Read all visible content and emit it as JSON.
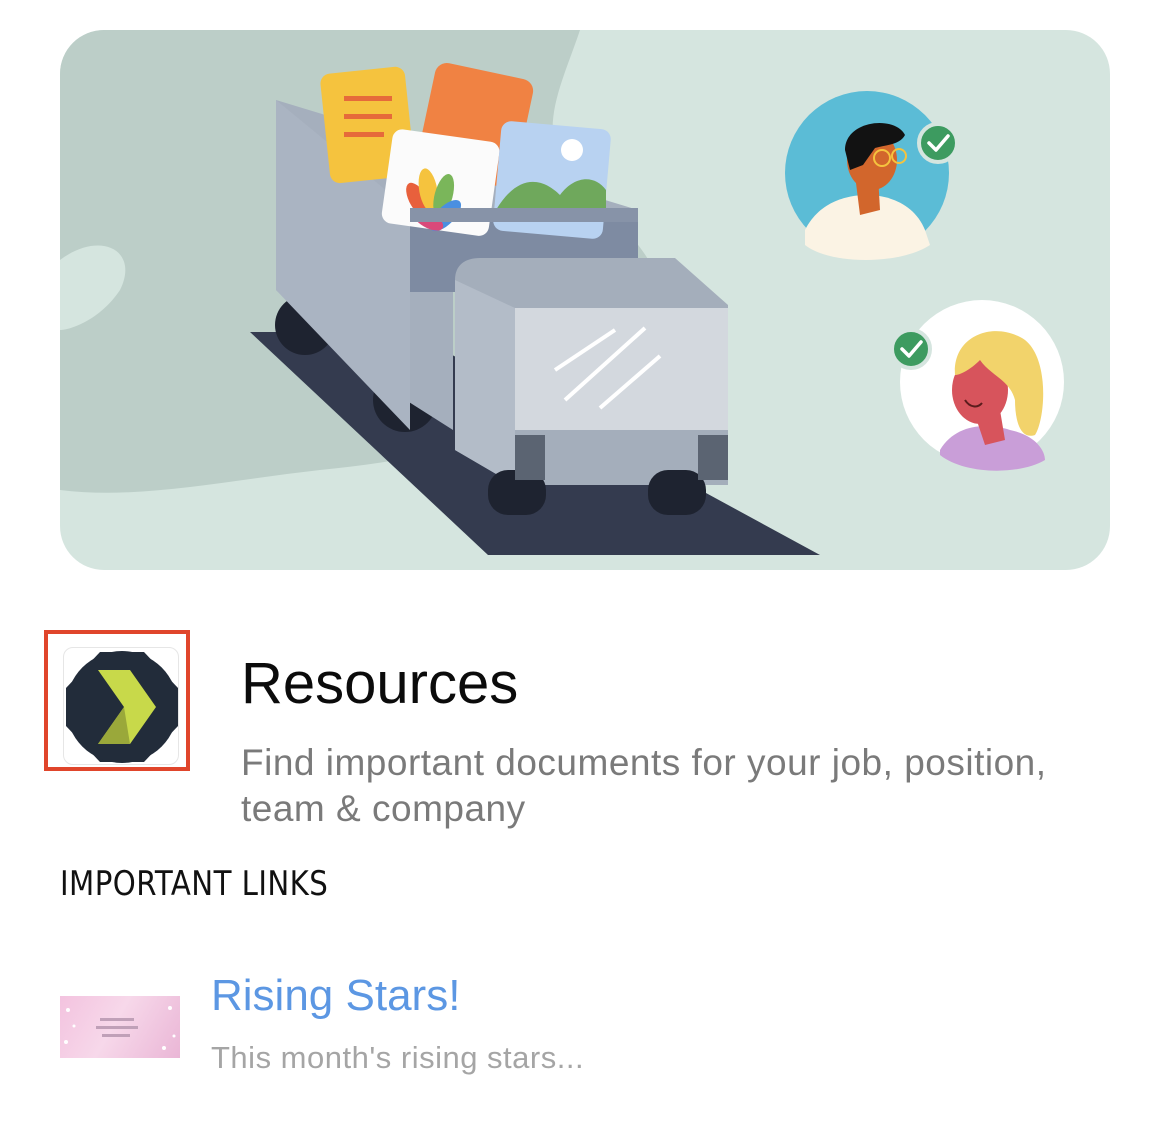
{
  "header": {
    "title": "Resources",
    "description": "Find important documents for your job, position, team & company"
  },
  "sections": [
    {
      "heading": "IMPORTANT LINKS",
      "links": [
        {
          "title": "Rising Stars!",
          "description": "This month's rising stars..."
        }
      ]
    }
  ],
  "icons": {
    "hero": "truck-with-documents-illustration",
    "app": "chevron-logo-icon",
    "check": "checkmark-icon"
  },
  "colors": {
    "link": "#5c97e3",
    "accent_highlight": "#e0452b",
    "logo_bg": "#222c3a",
    "logo_mark": "#c8d94a"
  }
}
